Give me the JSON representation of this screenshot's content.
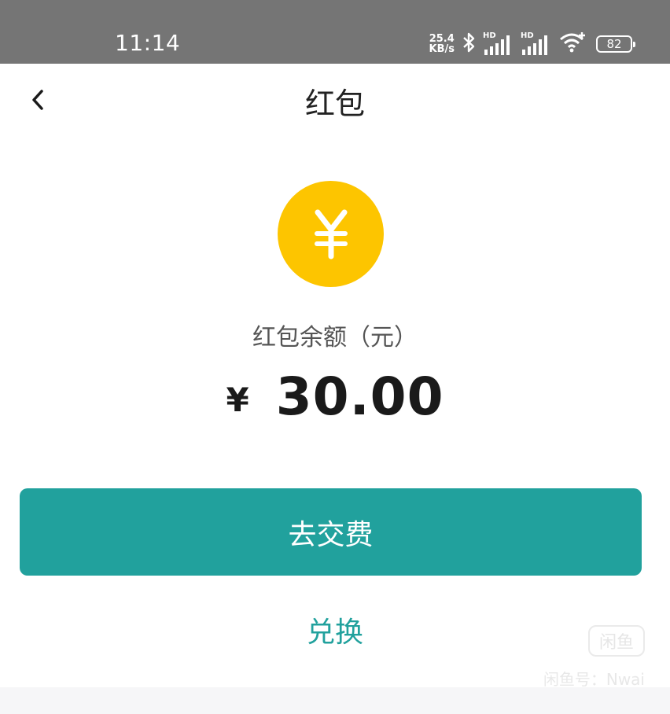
{
  "status_bar": {
    "time": "11:14",
    "net_speed_value": "25.4",
    "net_speed_unit": "KB/s",
    "signal_1_label": "HD",
    "signal_2_label": "HD",
    "battery_level": "82"
  },
  "header": {
    "title": "红包"
  },
  "balance": {
    "label": "红包余额（元）",
    "currency_symbol": "¥",
    "amount": "30.00"
  },
  "actions": {
    "primary_label": "去交费",
    "secondary_label": "兑换"
  },
  "watermark": {
    "logo_text": "闲鱼",
    "text": "闲鱼号：Nwai"
  },
  "colors": {
    "accent": "#21a19d",
    "coin": "#fdc500",
    "status_bar": "#757575"
  }
}
